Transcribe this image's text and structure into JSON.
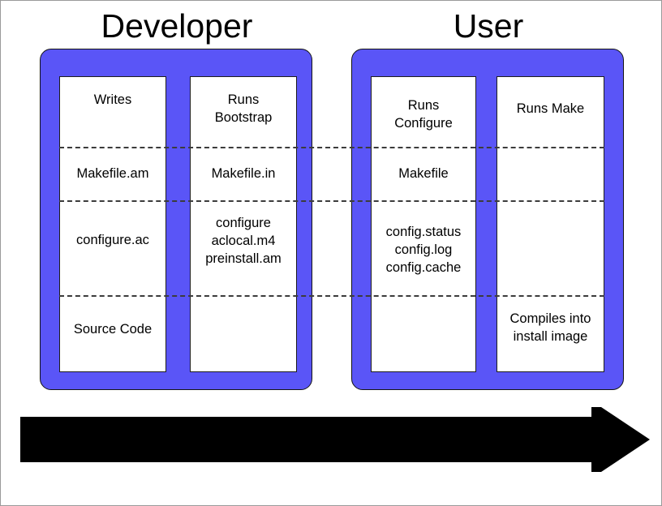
{
  "diagram": {
    "title_developer": "Developer",
    "title_user": "User",
    "colors": {
      "panel_blue": "#5a55f7",
      "box_white": "#ffffff",
      "outline_black": "#141414",
      "dash_gray": "#3c3c3c",
      "arrow_black": "#000000"
    },
    "arrow_direction": "left-to-right"
  },
  "groups": [
    {
      "name": "Developer",
      "columns": [
        {
          "name": "Writes",
          "cells": [
            {
              "row": 0,
              "text": "Writes"
            },
            {
              "row": 1,
              "text": "Makefile.am"
            },
            {
              "row": 2,
              "text": "configure.ac"
            },
            {
              "row": 3,
              "text": "Source Code"
            }
          ]
        },
        {
          "name": "Runs Bootstrap",
          "cells": [
            {
              "row": 0,
              "text": "Runs\nBootstrap"
            },
            {
              "row": 1,
              "text": "Makefile.in"
            },
            {
              "row": 2,
              "text": "configure\naclocal.m4\npreinstall.am"
            },
            {
              "row": 3,
              "text": ""
            }
          ]
        }
      ]
    },
    {
      "name": "User",
      "columns": [
        {
          "name": "Runs Configure",
          "cells": [
            {
              "row": 0,
              "text": "Runs\nConfigure"
            },
            {
              "row": 1,
              "text": "Makefile"
            },
            {
              "row": 2,
              "text": "config.status\nconfig.log\nconfig.cache"
            },
            {
              "row": 3,
              "text": ""
            }
          ]
        },
        {
          "name": "Runs Make",
          "cells": [
            {
              "row": 0,
              "text": "Runs Make"
            },
            {
              "row": 1,
              "text": ""
            },
            {
              "row": 2,
              "text": ""
            },
            {
              "row": 3,
              "text": "Compiles into\ninstall image"
            }
          ]
        }
      ]
    }
  ],
  "cell_text": {
    "writes_r0": "Writes",
    "writes_r1": "Makefile.am",
    "writes_r2": "configure.ac",
    "writes_r3": "Source Code",
    "bootstrap_r0": "Runs\nBootstrap",
    "bootstrap_r1": "Makefile.in",
    "bootstrap_r2": "configure\naclocal.m4\npreinstall.am",
    "configure_r0": "Runs\nConfigure",
    "configure_r1": "Makefile",
    "configure_r2": "config.status\nconfig.log\nconfig.cache",
    "make_r0": "Runs Make",
    "make_r3": "Compiles into\ninstall image"
  }
}
